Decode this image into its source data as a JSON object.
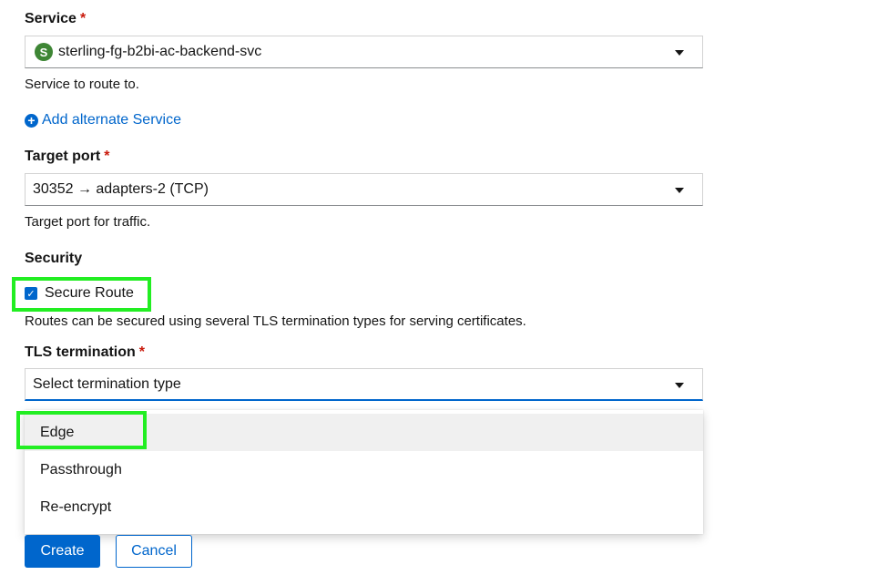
{
  "service": {
    "label": "Service",
    "required_mark": "*",
    "badge_letter": "S",
    "value": "sterling-fg-b2bi-ac-backend-svc",
    "help": "Service to route to.",
    "add_alternate_label": "Add alternate Service"
  },
  "target_port": {
    "label": "Target port",
    "required_mark": "*",
    "value": "30352 → adapters-2 (TCP)",
    "help": "Target port for traffic."
  },
  "security": {
    "heading": "Security",
    "secure_route_label": "Secure Route",
    "secure_route_checked": true,
    "help": "Routes can be secured using several TLS termination types for serving certificates."
  },
  "tls": {
    "label": "TLS termination",
    "required_mark": "*",
    "placeholder": "Select termination type",
    "options": [
      "Edge",
      "Passthrough",
      "Re-encrypt"
    ]
  },
  "actions": {
    "create_label": "Create",
    "cancel_label": "Cancel"
  },
  "colors": {
    "accent": "#0066cc",
    "required": "#c9190b",
    "service_badge": "#3e8635",
    "highlight": "#22ee22"
  }
}
